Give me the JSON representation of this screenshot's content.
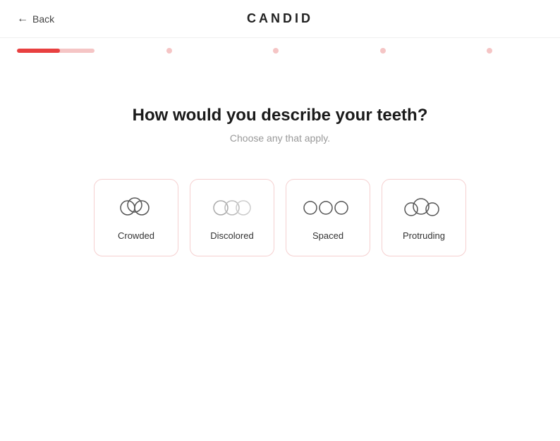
{
  "header": {
    "back_label": "Back",
    "logo": "CANDID"
  },
  "progress": {
    "fill_percent": 55,
    "dots": [
      "dot1",
      "dot2",
      "dot3",
      "dot4"
    ]
  },
  "question": {
    "title": "How would you describe your teeth?",
    "subtitle": "Choose any that apply."
  },
  "options": [
    {
      "id": "crowded",
      "label": "Crowded",
      "type": "crowded"
    },
    {
      "id": "discolored",
      "label": "Discolored",
      "type": "discolored"
    },
    {
      "id": "spaced",
      "label": "Spaced",
      "type": "spaced"
    },
    {
      "id": "protruding",
      "label": "Protruding",
      "type": "protruding"
    }
  ]
}
